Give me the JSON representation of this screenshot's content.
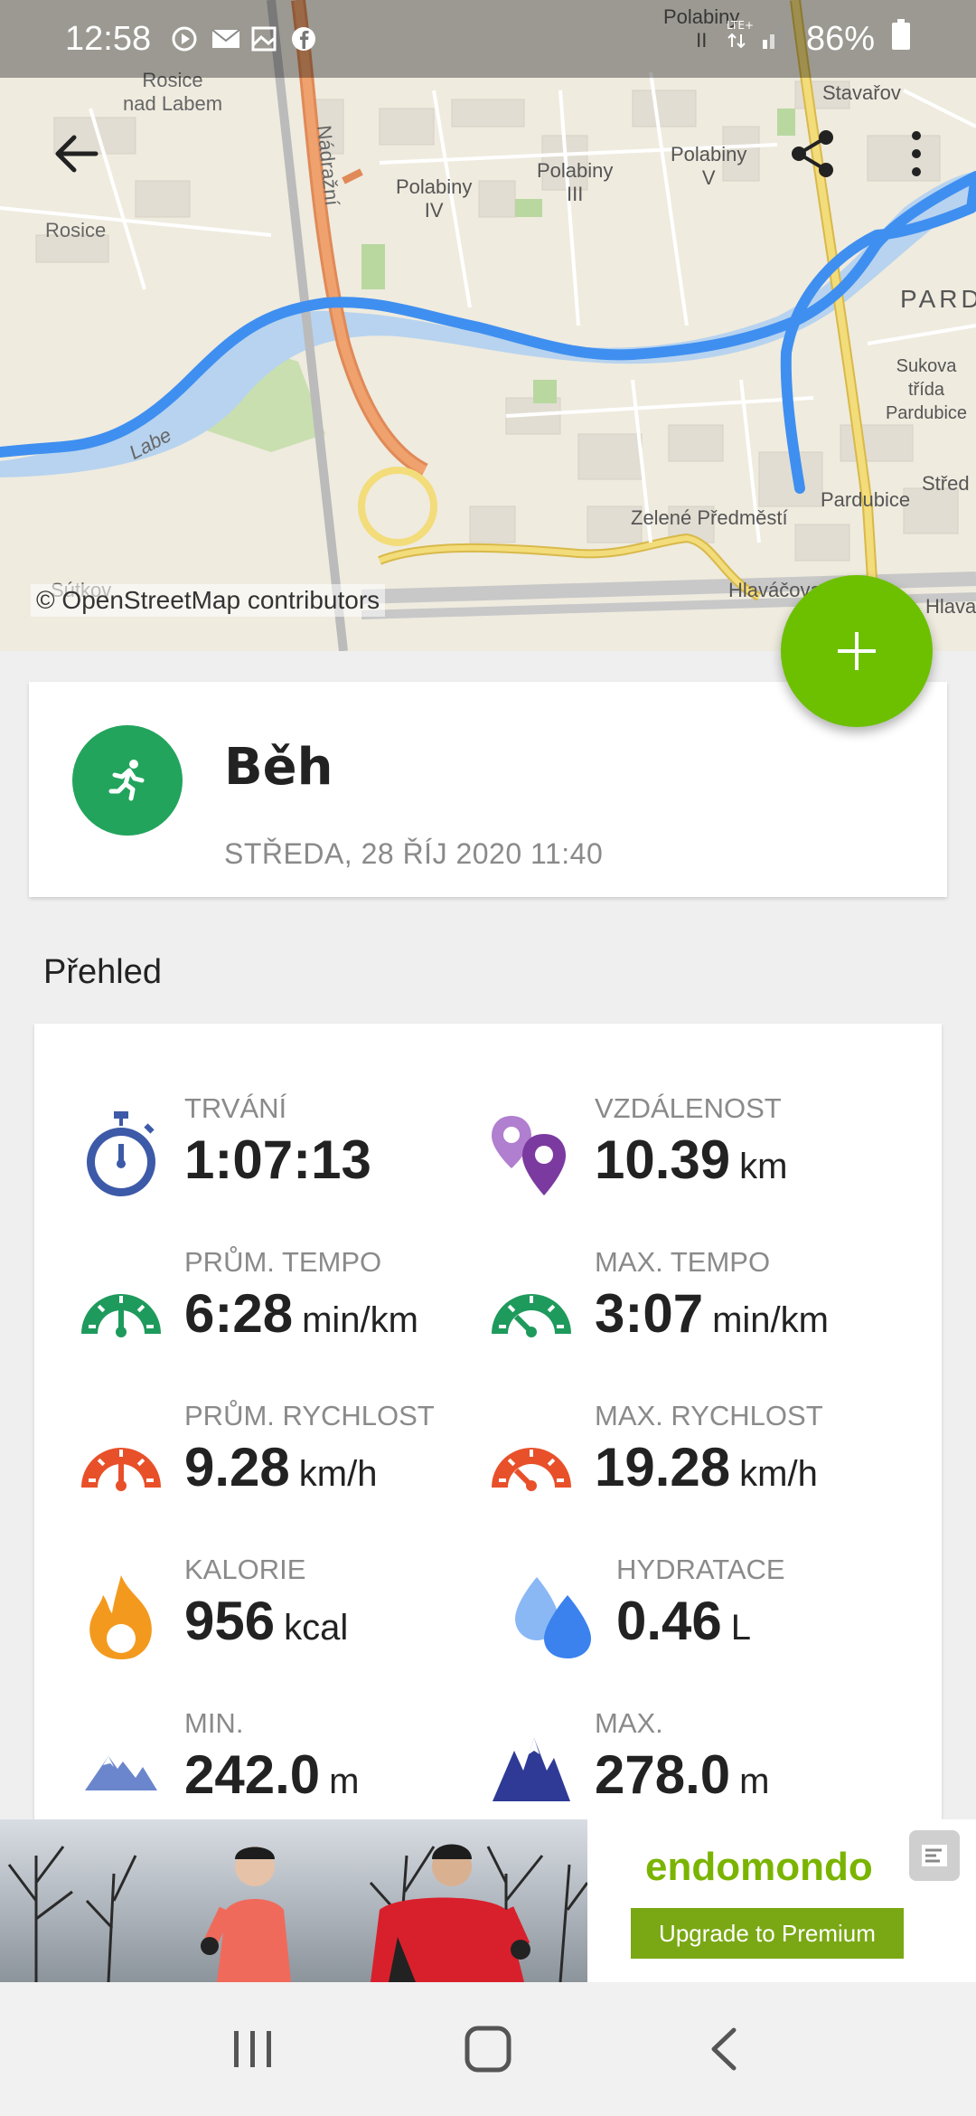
{
  "status_bar": {
    "time": "12:58",
    "battery": "86%",
    "icons": [
      "media-icon",
      "mail-icon",
      "gallery-icon",
      "facebook-icon"
    ]
  },
  "map": {
    "labels": {
      "rosice_nad_labem": "Rosice\nnad Labem",
      "rosice": "Rosice",
      "nadrazni": "Nádražní",
      "polabiny_iv": "Polabiny\nIV",
      "polabiny_iii": "Polabiny\nIII",
      "polabiny_v": "Polabiny\nV",
      "polabiny_ii": "Polabiny\nII",
      "stavarov": "Stavařov",
      "pard": "PARD",
      "sukova": "Sukova třída\nPardubice",
      "pardubice": "Pardubice",
      "stred": "Střed",
      "zelene": "Zelené Předměstí",
      "hlavacova": "Hlaváčova",
      "hlava": "Hlava",
      "labe": "Labe",
      "sutkov": "Sútkov"
    },
    "attribution": "© OpenStreetMap contributors",
    "route_color": "#3f8ff0"
  },
  "fab": {
    "icon": "plus-icon",
    "color": "#6cc000"
  },
  "activity": {
    "title": "Běh",
    "date": "STŘEDA, 28 ŘÍJ 2020 11:40",
    "icon": "running-icon",
    "badge_color": "#22a45d"
  },
  "overview": {
    "title": "Přehled",
    "stats": [
      {
        "label": "TRVÁNÍ",
        "value": "1:07:13",
        "unit": "",
        "icon": "stopwatch-icon",
        "color": "#3d5aa8"
      },
      {
        "label": "VZDÁLENOST",
        "value": "10.39",
        "unit": "km",
        "icon": "location-pins-icon",
        "color": "#7b3aa0"
      },
      {
        "label": "PRŮM. TEMPO",
        "value": "6:28",
        "unit": "min/km",
        "icon": "avg-pace-gauge-icon",
        "color": "#1e9a5c"
      },
      {
        "label": "MAX. TEMPO",
        "value": "3:07",
        "unit": "min/km",
        "icon": "max-pace-gauge-icon",
        "color": "#1e9a5c"
      },
      {
        "label": "PRŮM. RYCHLOST",
        "value": "9.28",
        "unit": "km/h",
        "icon": "avg-speed-gauge-icon",
        "color": "#e8502a"
      },
      {
        "label": "MAX. RYCHLOST",
        "value": "19.28",
        "unit": "km/h",
        "icon": "max-speed-gauge-icon",
        "color": "#e8502a"
      },
      {
        "label": "KALORIE",
        "value": "956",
        "unit": "kcal",
        "icon": "flame-icon",
        "color": "#f39a1e"
      },
      {
        "label": "HYDRATACE",
        "value": "0.46",
        "unit": "L",
        "icon": "water-drops-icon",
        "color": "#4a8ff0"
      },
      {
        "label": "MIN.",
        "value": "242.0",
        "unit": "m",
        "icon": "min-altitude-mountains-icon",
        "color": "#6b86cc"
      },
      {
        "label": "MAX.",
        "value": "278.0",
        "unit": "m",
        "icon": "max-altitude-mountains-icon",
        "color": "#2e3a96"
      }
    ]
  },
  "ad": {
    "brand": "endomondo",
    "button": "Upgrade to Premium"
  },
  "nav": {
    "recent": "recent-apps-icon",
    "home": "home-icon",
    "back": "back-icon"
  }
}
